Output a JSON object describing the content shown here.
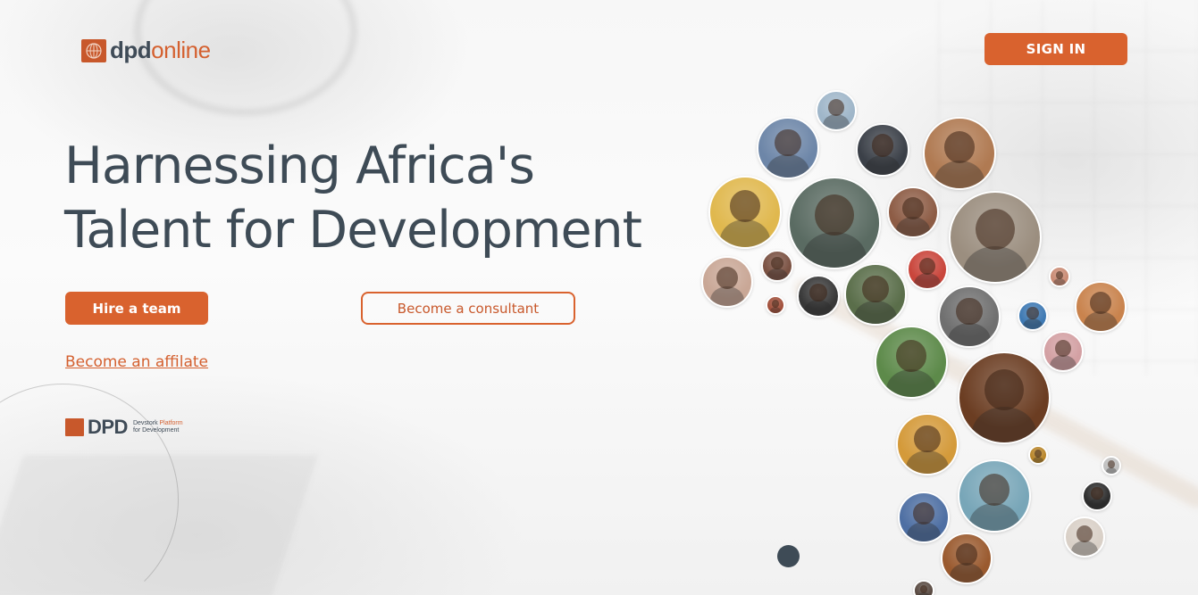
{
  "brand": {
    "name_prefix": "dpd",
    "name_suffix": "online",
    "accent_color": "#d9622e",
    "text_color": "#3e4b56"
  },
  "header": {
    "signin_label": "SIGN IN"
  },
  "hero": {
    "title_line1": "Harnessing Africa's",
    "title_line2": "Talent for Development",
    "hire_label": "Hire a team",
    "consultant_label": "Become a consultant",
    "affiliate_label": "Become an affilate"
  },
  "footer_logo": {
    "word": "DPD",
    "tag_part1": "Devstork ",
    "tag_accent": "Platform",
    "tag_part2": "for Development"
  },
  "carousel": {
    "current_slide": 1
  }
}
